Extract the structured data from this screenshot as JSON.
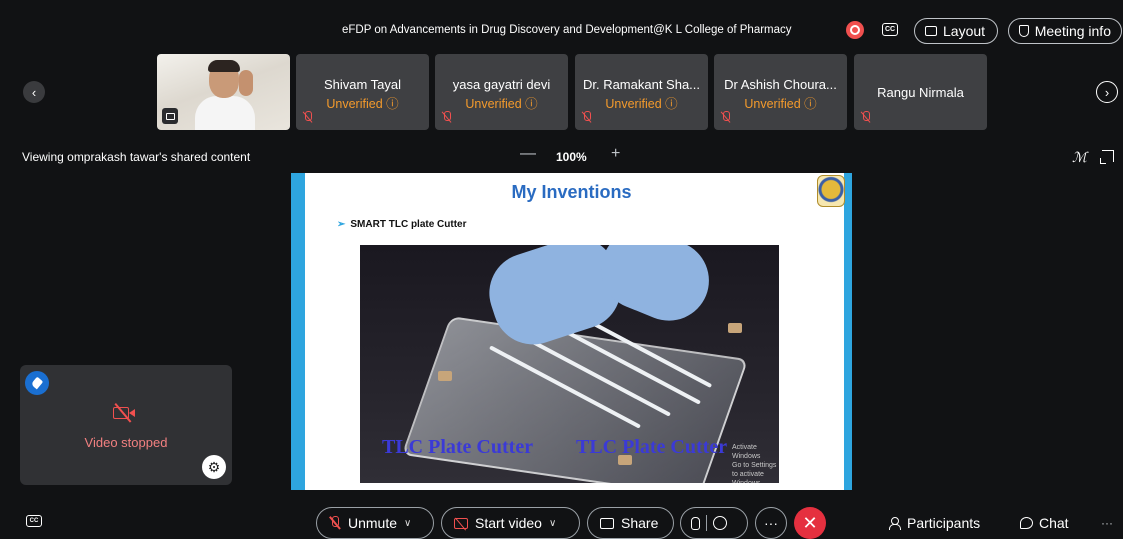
{
  "meeting": {
    "title": "eFDP on Advancements in Drug Discovery and Development@K L College of Pharmacy",
    "recording_color": "#f0504f",
    "cc_label": "CC"
  },
  "header_buttons": {
    "layout_label": "Layout",
    "meeting_info_label": "Meeting info"
  },
  "participants_strip": {
    "nav_prev": "‹",
    "nav_next": "›",
    "tiles": [
      {
        "name": "Shivam Tayal",
        "status": "Unverified ⓘ"
      },
      {
        "name": "yasa gayatri devi",
        "status": "Unverified ⓘ"
      },
      {
        "name": "Dr. Ramakant Sha...",
        "status": "Unverified ⓘ"
      },
      {
        "name": "Dr Ashish Choura...",
        "status": "Unverified ⓘ"
      },
      {
        "name": "Rangu Nirmala",
        "status": ""
      }
    ],
    "status_color": "#f39a2c",
    "muted_color": "#f0504f"
  },
  "sharing": {
    "viewing_label": "Viewing omprakash tawar's shared content",
    "zoom_minus": "—",
    "zoom_level": "100%",
    "zoom_plus": "+"
  },
  "slide": {
    "title": "My Inventions",
    "bullet_arrow": "➢",
    "bullet": "SMART TLC plate Cutter",
    "caption_left": "TLC Plate Cutter",
    "caption_right": "TLC Plate Cutter",
    "watermark_line1": "Activate Windows",
    "watermark_line2": "Go to Settings to activate Windows.",
    "accent_color": "#2ea5df",
    "title_color": "#2a6bc1"
  },
  "self_view": {
    "status": "Video stopped",
    "settings_glyph": "⚙"
  },
  "controls": {
    "cc_label": "CC",
    "unmute_label": "Unmute",
    "start_video_label": "Start video",
    "share_label": "Share",
    "more_label": "···",
    "end_label": "✕",
    "participants_label": "Participants",
    "chat_label": "Chat",
    "overflow_label": "···",
    "caret": "∨",
    "end_color": "#e5303f"
  }
}
